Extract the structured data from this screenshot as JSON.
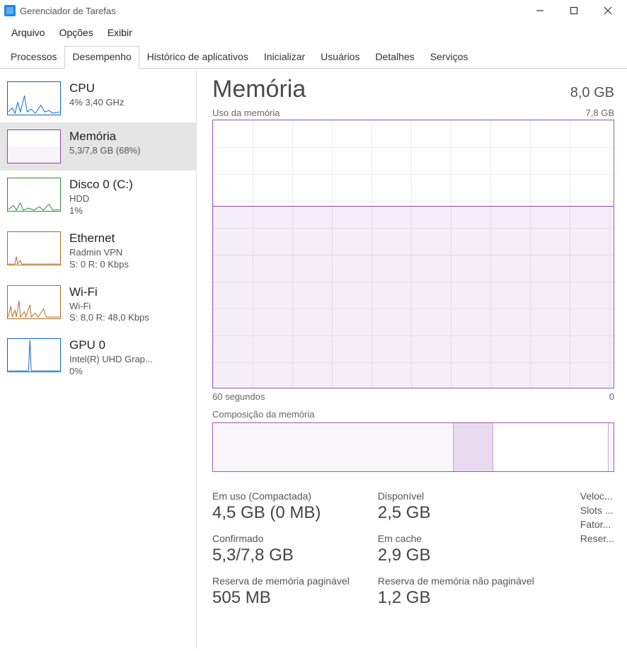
{
  "window": {
    "title": "Gerenciador de Tarefas"
  },
  "menu": {
    "file": "Arquivo",
    "options": "Opções",
    "view": "Exibir"
  },
  "tabs": {
    "processes": "Processos",
    "performance": "Desempenho",
    "apphistory": "Histórico de aplicativos",
    "startup": "Inicializar",
    "users": "Usuários",
    "details": "Detalhes",
    "services": "Serviços"
  },
  "sidebar": {
    "cpu": {
      "title": "CPU",
      "sub": "4% 3,40 GHz"
    },
    "memory": {
      "title": "Memória",
      "sub": "5,3/7,8 GB (68%)"
    },
    "disk": {
      "title": "Disco 0 (C:)",
      "sub1": "HDD",
      "sub2": "1%"
    },
    "eth": {
      "title": "Ethernet",
      "sub1": "Radmin VPN",
      "sub2": "S: 0 R: 0 Kbps"
    },
    "wifi": {
      "title": "Wi-Fi",
      "sub1": "Wi-Fi",
      "sub2": "S: 8,0 R: 48,0 Kbps"
    },
    "gpu": {
      "title": "GPU 0",
      "sub1": "Intel(R) UHD Grap...",
      "sub2": "0%"
    }
  },
  "main": {
    "title": "Memória",
    "total": "8,0 GB",
    "chart_label": "Uso da memória",
    "chart_max": "7,8 GB",
    "x_left": "60 segundos",
    "x_right": "0",
    "comp_label": "Composição da memória"
  },
  "stats": {
    "inuse_label": "Em uso (Compactada)",
    "inuse_val": "4,5 GB (0 MB)",
    "avail_label": "Disponível",
    "avail_val": "2,5 GB",
    "commit_label": "Confirmado",
    "commit_val": "5,3/7,8 GB",
    "cache_label": "Em cache",
    "cache_val": "2,9 GB",
    "paged_label": "Reserva de memória paginável",
    "paged_val": "505 MB",
    "nonpaged_label": "Reserva de memória não paginável",
    "nonpaged_val": "1,2 GB"
  },
  "right_info": {
    "speed": "Veloc...",
    "slots": "Slots ...",
    "form": "Fator...",
    "reserved": "Reser..."
  },
  "chart_data": {
    "type": "area",
    "title": "Uso da memória",
    "xlabel": "segundos",
    "ylabel": "GB",
    "xlim": [
      60,
      0
    ],
    "ylim": [
      0,
      7.8
    ],
    "x": [
      60,
      55,
      50,
      45,
      40,
      35,
      30,
      25,
      20,
      15,
      10,
      5,
      0
    ],
    "values": [
      5.3,
      5.3,
      5.3,
      5.3,
      5.3,
      5.3,
      5.3,
      5.3,
      5.3,
      5.3,
      5.3,
      5.3,
      5.3
    ],
    "composition": {
      "in_use_gb": 4.5,
      "modified_gb": 0.8,
      "standby_gb": 2.1,
      "free_gb": 0.4,
      "total_gb": 7.8
    }
  }
}
